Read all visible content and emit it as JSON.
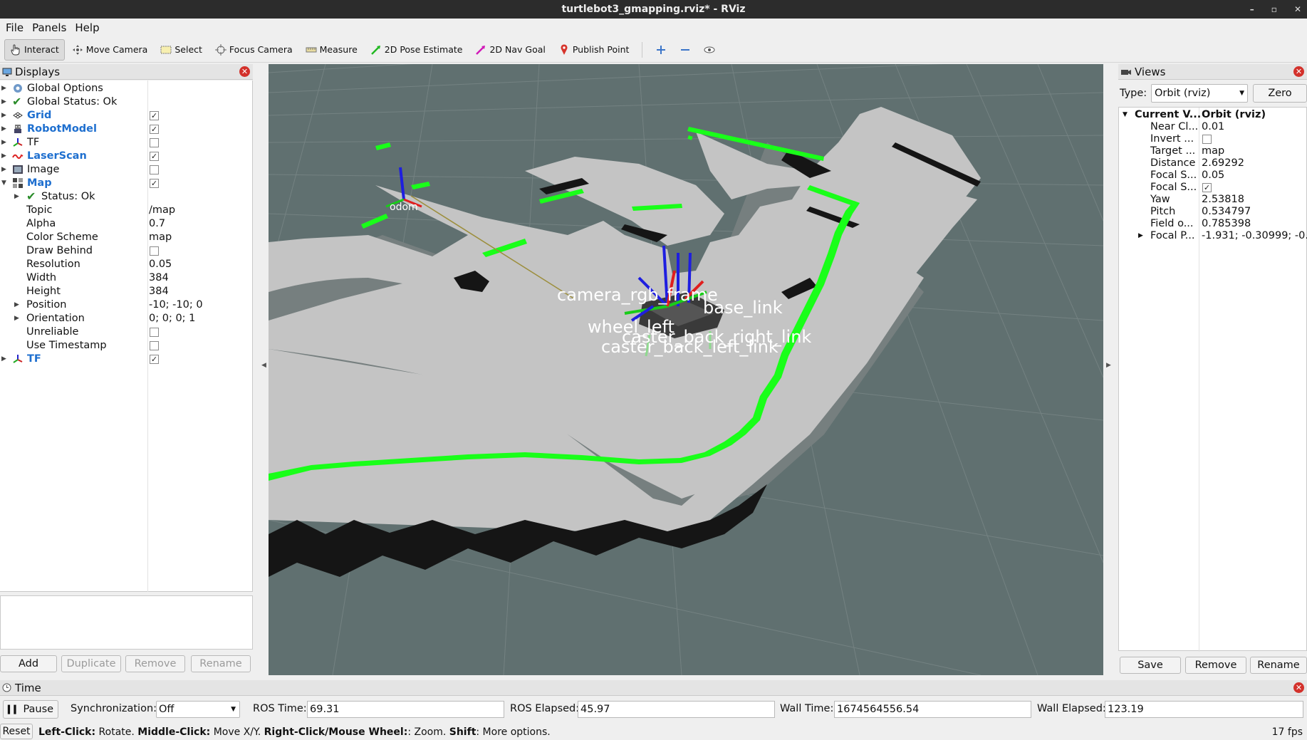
{
  "window": {
    "title": "turtlebot3_gmapping.rviz* - RViz",
    "controls": [
      "–",
      "▫",
      "✕"
    ]
  },
  "menu": [
    "File",
    "Panels",
    "Help"
  ],
  "toolbar": {
    "tools": [
      {
        "label": "Interact",
        "icon": "hand-icon"
      },
      {
        "label": "Move Camera",
        "icon": "move-camera-icon"
      },
      {
        "label": "Select",
        "icon": "select-icon"
      },
      {
        "label": "Focus Camera",
        "icon": "focus-camera-icon"
      },
      {
        "label": "Measure",
        "icon": "measure-icon"
      },
      {
        "label": "2D Pose Estimate",
        "icon": "pose-estimate-arrow-icon"
      },
      {
        "label": "2D Nav Goal",
        "icon": "nav-goal-arrow-icon"
      },
      {
        "label": "Publish Point",
        "icon": "map-pin-icon"
      }
    ],
    "extra_icons": [
      "plus-icon",
      "minus-icon",
      "eye-icon"
    ]
  },
  "displays": {
    "title": "Displays",
    "rows": [
      {
        "label": "Global Options",
        "icon": "gear-icon",
        "arrow": true
      },
      {
        "label": "Global Status: Ok",
        "icon": "checkmark-icon",
        "arrow": true
      },
      {
        "label": "Grid",
        "icon": "grid-icon",
        "arrow": true,
        "blue": true,
        "checked": true
      },
      {
        "label": "RobotModel",
        "icon": "robot-icon",
        "arrow": true,
        "blue": true,
        "checked": true
      },
      {
        "label": "TF",
        "icon": "tf-icon",
        "arrow": true,
        "checked": false
      },
      {
        "label": "LaserScan",
        "icon": "laser-icon",
        "arrow": true,
        "blue": true,
        "checked": true
      },
      {
        "label": "Image",
        "icon": "image-icon",
        "arrow": true,
        "checked": false
      },
      {
        "label": "Map",
        "icon": "map-icon",
        "arrow": true,
        "expanded": true,
        "blue": true,
        "checked": true
      }
    ],
    "map_children": [
      {
        "label": "Status: Ok",
        "icon": "checkmark-icon",
        "arrow": true
      },
      {
        "label": "Topic",
        "value": "/map"
      },
      {
        "label": "Alpha",
        "value": "0.7"
      },
      {
        "label": "Color Scheme",
        "value": "map"
      },
      {
        "label": "Draw Behind",
        "checked": false
      },
      {
        "label": "Resolution",
        "value": "0.05"
      },
      {
        "label": "Width",
        "value": "384"
      },
      {
        "label": "Height",
        "value": "384"
      },
      {
        "label": "Position",
        "value": "-10; -10; 0",
        "arrow": true
      },
      {
        "label": "Orientation",
        "value": "0; 0; 0; 1",
        "arrow": true
      },
      {
        "label": "Unreliable",
        "checked": false
      },
      {
        "label": "Use Timestamp",
        "checked": false
      }
    ],
    "last_row": {
      "label": "TF",
      "icon": "tf-icon",
      "arrow": true,
      "blue": true,
      "checked": true
    },
    "buttons": {
      "add": "Add",
      "duplicate": "Duplicate",
      "remove": "Remove",
      "rename": "Rename"
    }
  },
  "scene": {
    "labels": [
      "odom",
      "camera_rgb_frame",
      "base_link",
      "wheel_left",
      "caster_back_right_link",
      "caster_back_left_link"
    ],
    "colors": {
      "background": "#607070",
      "free": "#c4c4c4",
      "occupied": "#151515",
      "unknown": "#777f7f",
      "laser": "#19ff19"
    }
  },
  "views": {
    "title": "Views",
    "type_label": "Type:",
    "type_value": "Orbit (rviz)",
    "zero_label": "Zero",
    "header": {
      "label": "Current V...",
      "value": "Orbit (rviz)"
    },
    "rows": [
      {
        "label": "Near Cl...",
        "value": "0.01"
      },
      {
        "label": "Invert ...",
        "checked": false
      },
      {
        "label": "Target ...",
        "value": "map"
      },
      {
        "label": "Distance",
        "value": "2.69292"
      },
      {
        "label": "Focal S...",
        "value": "0.05"
      },
      {
        "label": "Focal S...",
        "checked": true
      },
      {
        "label": "Yaw",
        "value": "2.53818"
      },
      {
        "label": "Pitch",
        "value": "0.534797"
      },
      {
        "label": "Field o...",
        "value": "0.785398"
      },
      {
        "label": "Focal P...",
        "value": "-1.931; -0.30999; -0....",
        "arrow": true
      }
    ],
    "buttons": {
      "save": "Save",
      "remove": "Remove",
      "rename": "Rename"
    }
  },
  "time": {
    "title": "Time",
    "pause": "Pause",
    "sync_label": "Synchronization:",
    "sync_value": "Off",
    "ros_time_label": "ROS Time:",
    "ros_time": "69.31",
    "ros_elapsed_label": "ROS Elapsed:",
    "ros_elapsed": "45.97",
    "wall_time_label": "Wall Time:",
    "wall_time": "1674564556.54",
    "wall_elapsed_label": "Wall Elapsed:",
    "wall_elapsed": "123.19"
  },
  "status": {
    "reset": "Reset",
    "left_click": "Left-Click:",
    "left_click_text": " Rotate. ",
    "middle_click": "Middle-Click:",
    "middle_click_text": " Move X/Y. ",
    "right_click": "Right-Click/Mouse Wheel:",
    "right_click_text": ": Zoom. ",
    "shift": "Shift",
    "shift_text": ": More options.",
    "fps": "17 fps"
  }
}
